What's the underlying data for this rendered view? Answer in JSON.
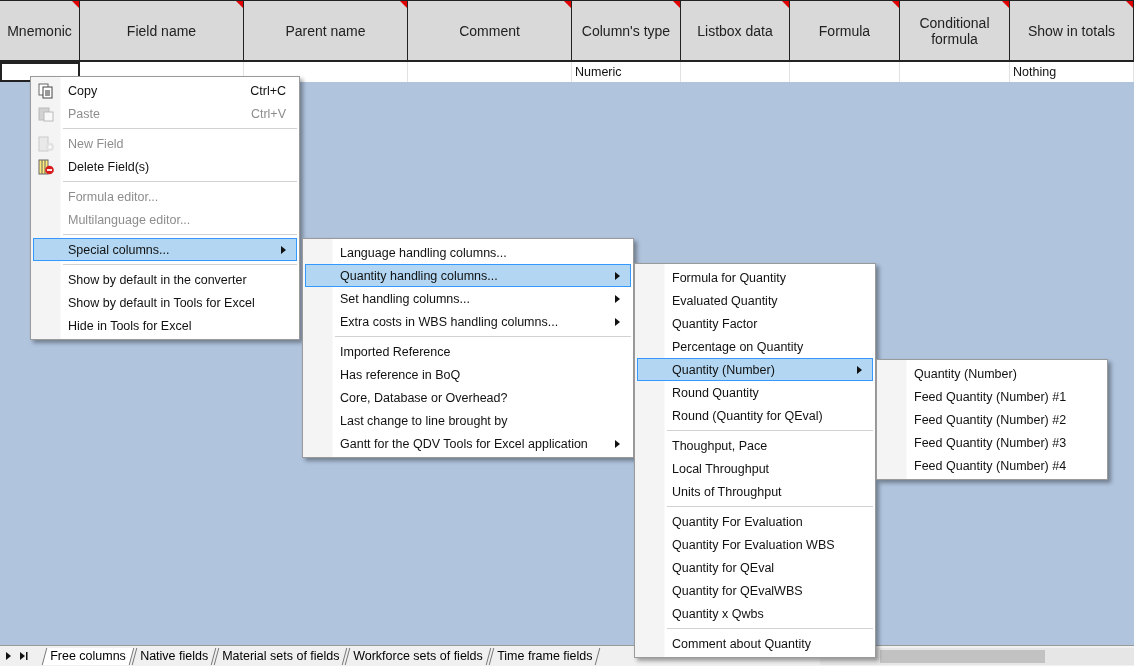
{
  "table": {
    "columns": [
      {
        "label": "Mnemonic"
      },
      {
        "label": "Field name"
      },
      {
        "label": "Parent name"
      },
      {
        "label": "Comment"
      },
      {
        "label": "Column's type"
      },
      {
        "label": "Listbox data"
      },
      {
        "label": "Formula"
      },
      {
        "label": "Conditional formula"
      },
      {
        "label": "Show in totals"
      }
    ],
    "rows": [
      {
        "cells": [
          "",
          "",
          "",
          "",
          "Numeric",
          "",
          "",
          "",
          "Nothing"
        ]
      }
    ]
  },
  "menus": [
    {
      "items": [
        {
          "kind": "item",
          "label": "Copy",
          "shortcut": "Ctrl+C",
          "disabled": false,
          "selected": false
        },
        {
          "kind": "item",
          "label": "Paste",
          "shortcut": "Ctrl+V",
          "disabled": true,
          "selected": false
        },
        {
          "kind": "separator"
        },
        {
          "kind": "item",
          "label": "New Field",
          "disabled": true,
          "selected": false
        },
        {
          "kind": "item",
          "label": "Delete Field(s)",
          "disabled": false,
          "selected": false
        },
        {
          "kind": "separator"
        },
        {
          "kind": "item",
          "label": "Formula editor...",
          "disabled": true,
          "selected": false
        },
        {
          "kind": "item",
          "label": "Multilanguage editor...",
          "disabled": true,
          "selected": false
        },
        {
          "kind": "separator"
        },
        {
          "kind": "submenu",
          "label": "Special columns...",
          "disabled": false,
          "selected": true
        },
        {
          "kind": "separator"
        },
        {
          "kind": "item",
          "label": "Show by default in the converter",
          "disabled": false,
          "selected": false
        },
        {
          "kind": "item",
          "label": "Show by default in Tools for Excel",
          "disabled": false,
          "selected": false
        },
        {
          "kind": "item",
          "label": "Hide in Tools for Excel",
          "disabled": false,
          "selected": false
        }
      ]
    },
    {
      "items": [
        {
          "kind": "item",
          "label": "Language handling columns...",
          "disabled": false,
          "selected": false
        },
        {
          "kind": "submenu",
          "label": "Quantity handling columns...",
          "disabled": false,
          "selected": true
        },
        {
          "kind": "submenu",
          "label": "Set handling columns...",
          "disabled": false,
          "selected": false
        },
        {
          "kind": "submenu",
          "label": "Extra costs in WBS handling columns...",
          "disabled": false,
          "selected": false
        },
        {
          "kind": "separator"
        },
        {
          "kind": "item",
          "label": "Imported Reference",
          "disabled": false,
          "selected": false
        },
        {
          "kind": "item",
          "label": "Has reference in BoQ",
          "disabled": false,
          "selected": false
        },
        {
          "kind": "item",
          "label": "Core, Database or Overhead?",
          "disabled": false,
          "selected": false
        },
        {
          "kind": "item",
          "label": "Last change to line brought by",
          "disabled": false,
          "selected": false
        },
        {
          "kind": "submenu",
          "label": "Gantt for the QDV Tools for Excel application",
          "disabled": false,
          "selected": false
        }
      ]
    },
    {
      "items": [
        {
          "kind": "item",
          "label": "Formula for Quantity",
          "disabled": false,
          "selected": false
        },
        {
          "kind": "item",
          "label": "Evaluated Quantity",
          "disabled": false,
          "selected": false
        },
        {
          "kind": "item",
          "label": "Quantity Factor",
          "disabled": false,
          "selected": false
        },
        {
          "kind": "item",
          "label": "Percentage on Quantity",
          "disabled": false,
          "selected": false
        },
        {
          "kind": "submenu",
          "label": "Quantity (Number)",
          "disabled": false,
          "selected": true
        },
        {
          "kind": "item",
          "label": "Round Quantity",
          "disabled": false,
          "selected": false
        },
        {
          "kind": "item",
          "label": "Round (Quantity for QEval)",
          "disabled": false,
          "selected": false
        },
        {
          "kind": "separator"
        },
        {
          "kind": "item",
          "label": "Thoughput, Pace",
          "disabled": false,
          "selected": false
        },
        {
          "kind": "item",
          "label": "Local Throughput",
          "disabled": false,
          "selected": false
        },
        {
          "kind": "item",
          "label": "Units of Throughput",
          "disabled": false,
          "selected": false
        },
        {
          "kind": "separator"
        },
        {
          "kind": "item",
          "label": "Quantity For Evaluation",
          "disabled": false,
          "selected": false
        },
        {
          "kind": "item",
          "label": "Quantity For Evaluation WBS",
          "disabled": false,
          "selected": false
        },
        {
          "kind": "item",
          "label": "Quantity for QEval",
          "disabled": false,
          "selected": false
        },
        {
          "kind": "item",
          "label": "Quantity for QEvalWBS",
          "disabled": false,
          "selected": false
        },
        {
          "kind": "item",
          "label": "Quantity x Qwbs",
          "disabled": false,
          "selected": false
        },
        {
          "kind": "separator"
        },
        {
          "kind": "item",
          "label": "Comment about Quantity",
          "disabled": false,
          "selected": false
        }
      ]
    },
    {
      "items": [
        {
          "kind": "item",
          "label": "Quantity (Number)",
          "disabled": false,
          "selected": false
        },
        {
          "kind": "item",
          "label": "Feed Quantity (Number) #1",
          "disabled": false,
          "selected": false
        },
        {
          "kind": "item",
          "label": "Feed Quantity (Number) #2",
          "disabled": false,
          "selected": false
        },
        {
          "kind": "item",
          "label": "Feed Quantity (Number) #3",
          "disabled": false,
          "selected": false
        },
        {
          "kind": "item",
          "label": "Feed Quantity (Number) #4",
          "disabled": false,
          "selected": false
        }
      ]
    }
  ],
  "sheet_tabs": [
    {
      "label": "Free columns",
      "selected": true
    },
    {
      "label": "Native fields",
      "selected": false
    },
    {
      "label": "Material sets of fields",
      "selected": false
    },
    {
      "label": "Workforce sets of fields",
      "selected": false
    },
    {
      "label": "Time frame fields",
      "selected": false
    }
  ]
}
